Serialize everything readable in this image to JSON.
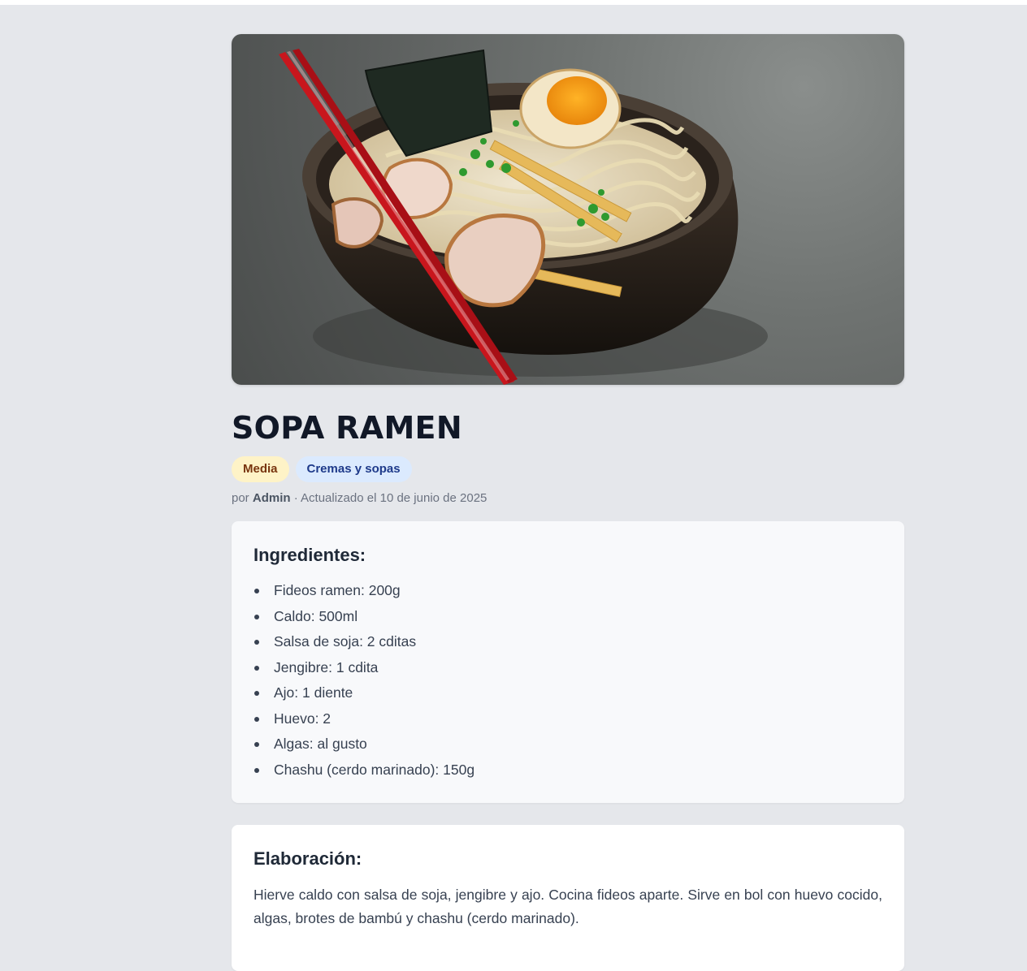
{
  "recipe": {
    "title": "SOPA RAMEN",
    "image_alt": "Sopa ramen",
    "badges": {
      "difficulty": "Media",
      "category": "Cremas y sopas"
    },
    "meta": {
      "prefix": "por",
      "author": "Admin",
      "updated": "· Actualizado el 10 de junio de 2025"
    },
    "ingredients": {
      "heading": "Ingredientes:",
      "items": [
        "Fideos ramen: 200g",
        "Caldo: 500ml",
        "Salsa de soja: 2 cditas",
        "Jengibre: 1 cdita",
        "Ajo: 1 diente",
        "Huevo: 2",
        "Algas: al gusto",
        "Chashu (cerdo marinado): 150g"
      ]
    },
    "elaboration": {
      "heading": "Elaboración:",
      "text": "Hierve caldo con salsa de soja, jengibre y ajo. Cocina fideos aparte. Sirve en bol con huevo cocido, algas, brotes de bambú y chashu (cerdo marinado)."
    }
  },
  "colors": {
    "page_background": "#e5e7eb",
    "difficulty_badge": "#fef3c7",
    "category_badge": "#dbeafe",
    "chopsticks": "#c8161d"
  }
}
